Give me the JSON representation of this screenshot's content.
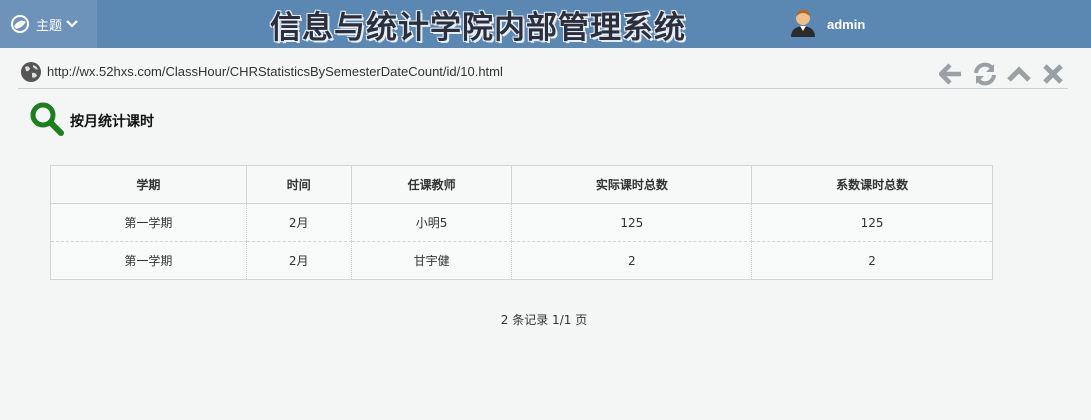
{
  "header": {
    "theme_label": "主题",
    "system_title": "信息与统计学院内部管理系统",
    "username": "admin"
  },
  "address_bar": {
    "url": "http://wx.52hxs.com/ClassHour/CHRStatisticsBySemesterDateCount/id/10.html"
  },
  "toolbar_icons": [
    "back-arrow-icon",
    "refresh-icon",
    "collapse-up-icon",
    "close-icon"
  ],
  "section": {
    "title": "按月统计课时"
  },
  "table": {
    "headers": [
      "学期",
      "时间",
      "任课教师",
      "实际课时总数",
      "系数课时总数"
    ],
    "rows": [
      [
        "第一学期",
        "2月",
        "小明5",
        "125",
        "125"
      ],
      [
        "第一学期",
        "2月",
        "甘宇健",
        "2",
        "2"
      ]
    ]
  },
  "pager": {
    "summary": "2 条记录 1/1 页"
  },
  "colors": {
    "header_bg": "#5b87b3",
    "theme_bg": "#6d93ba",
    "search_icon": "#1b7f1b",
    "toolbar_icon": "#9aa0a4"
  }
}
